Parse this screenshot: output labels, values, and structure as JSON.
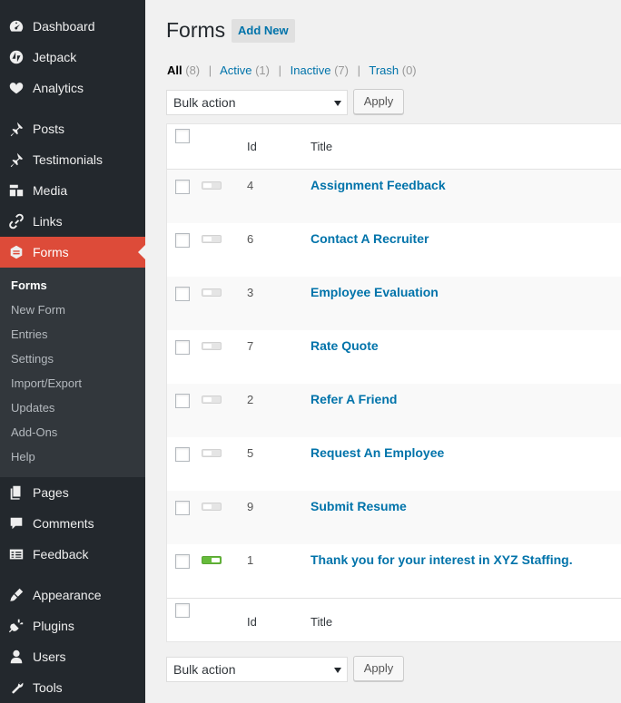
{
  "sidebar": {
    "items": [
      {
        "label": "Dashboard",
        "icon": "dashboard-icon"
      },
      {
        "label": "Jetpack",
        "icon": "jetpack-icon"
      },
      {
        "label": "Analytics",
        "icon": "analytics-icon"
      },
      {
        "label": "Posts",
        "icon": "pin-icon"
      },
      {
        "label": "Testimonials",
        "icon": "pin-icon"
      },
      {
        "label": "Media",
        "icon": "media-icon"
      },
      {
        "label": "Links",
        "icon": "link-icon"
      },
      {
        "label": "Forms",
        "icon": "forms-icon",
        "active": true
      },
      {
        "label": "Pages",
        "icon": "pages-icon"
      },
      {
        "label": "Comments",
        "icon": "comments-icon"
      },
      {
        "label": "Feedback",
        "icon": "feedback-icon"
      },
      {
        "label": "Appearance",
        "icon": "appearance-icon"
      },
      {
        "label": "Plugins",
        "icon": "plugins-icon"
      },
      {
        "label": "Users",
        "icon": "users-icon"
      },
      {
        "label": "Tools",
        "icon": "tools-icon"
      }
    ],
    "submenu": [
      "Forms",
      "New Form",
      "Entries",
      "Settings",
      "Import/Export",
      "Updates",
      "Add-Ons",
      "Help"
    ]
  },
  "header": {
    "title": "Forms",
    "add_new": "Add New"
  },
  "views": [
    {
      "label": "All",
      "count": "(8)"
    },
    {
      "label": "Active",
      "count": "(1)"
    },
    {
      "label": "Inactive",
      "count": "(7)"
    },
    {
      "label": "Trash",
      "count": "(0)"
    }
  ],
  "bulk": {
    "select_value": "Bulk action",
    "apply_label": "Apply"
  },
  "table": {
    "columns": {
      "id": "Id",
      "title": "Title"
    },
    "rows": [
      {
        "id": "4",
        "title": "Assignment Feedback",
        "active": false
      },
      {
        "id": "6",
        "title": "Contact A Recruiter",
        "active": false
      },
      {
        "id": "3",
        "title": "Employee Evaluation",
        "active": false
      },
      {
        "id": "7",
        "title": "Rate Quote",
        "active": false
      },
      {
        "id": "2",
        "title": "Refer A Friend",
        "active": false
      },
      {
        "id": "5",
        "title": "Request An Employee",
        "active": false
      },
      {
        "id": "9",
        "title": "Submit Resume",
        "active": false
      },
      {
        "id": "1",
        "title": "Thank you for your interest in XYZ Staffing.",
        "active": true
      }
    ]
  },
  "colors": {
    "sidebar_bg": "#23282d",
    "active_menu": "#dd4b39",
    "link": "#0073aa",
    "toggle_on": "#66bb3b"
  }
}
